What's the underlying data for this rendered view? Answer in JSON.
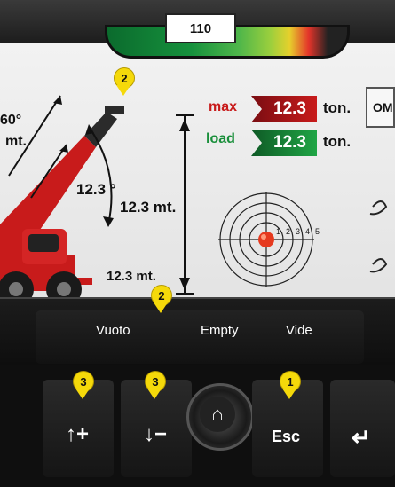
{
  "display": {
    "counter": "110",
    "angle_top": "60°",
    "reach_left": "mt.",
    "boom_angle": "12.3 °",
    "height": "12.3 mt.",
    "radius": "12.3 mt.",
    "max_label": "max",
    "max_value": "12.3",
    "max_unit": "ton.",
    "load_label": "load",
    "load_value": "12.3",
    "load_unit": "ton.",
    "om_label": "OM",
    "target_rings": [
      "1",
      "2",
      "3",
      "4",
      "5"
    ]
  },
  "status": {
    "it": "Vuoto",
    "en": "Empty",
    "fr": "Vide"
  },
  "markers": {
    "top_marker": "2",
    "mid_marker": "2",
    "btn_up_marker": "3",
    "btn_down_marker": "3",
    "btn_esc_marker": "1"
  },
  "buttons": {
    "up": "↑+",
    "down": "↓−",
    "esc": "Esc",
    "enter": "↵"
  },
  "colors": {
    "max_fill": "#b3121c",
    "load_fill": "#1a8f3b",
    "marker": "#f5d90a"
  }
}
